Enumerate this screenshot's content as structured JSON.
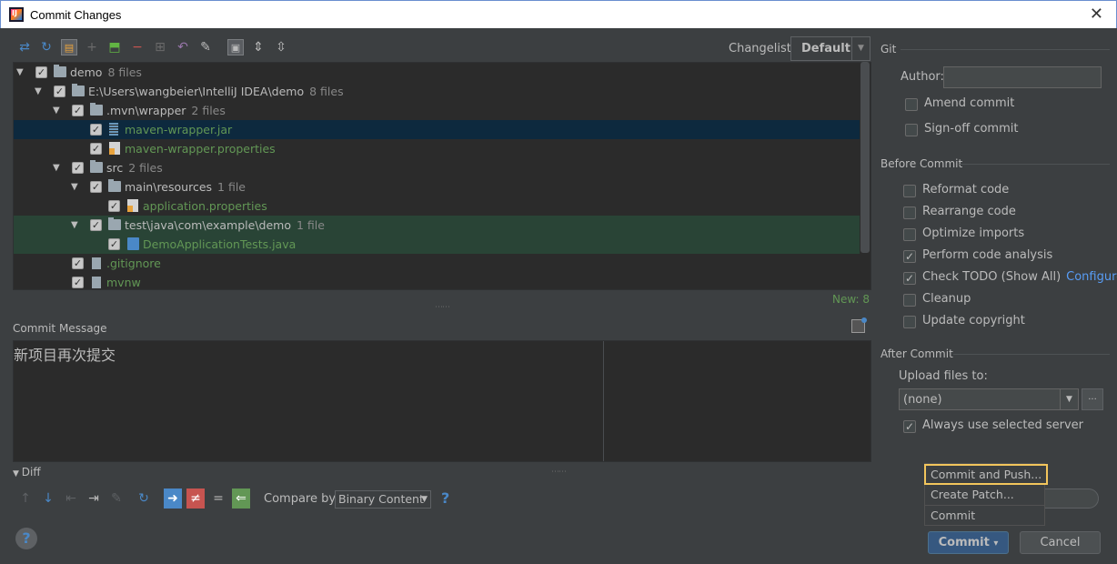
{
  "window": {
    "title": "Commit Changes",
    "close": "✕"
  },
  "toolbar": {
    "icons": [
      "show-diff-icon",
      "refresh-icon",
      "group-by-icon",
      "add-icon",
      "move-icon",
      "remove-icon",
      "compare-icon",
      "rollback-icon",
      "edit-icon",
      "toggle-icon",
      "expand-all-icon",
      "collapse-all-icon"
    ]
  },
  "changelist": {
    "label": "Changelist:",
    "value": "Default"
  },
  "tree": {
    "rows": [
      {
        "name": "demo",
        "count": "8 files"
      },
      {
        "name": "E:\\Users\\wangbeier\\IntelliJ IDEA\\demo",
        "count": "8 files"
      },
      {
        "name": ".mvn\\wrapper",
        "count": "2 files"
      },
      {
        "name": "maven-wrapper.jar",
        "count": ""
      },
      {
        "name": "maven-wrapper.properties",
        "count": ""
      },
      {
        "name": "src",
        "count": "2 files"
      },
      {
        "name": "main\\resources",
        "count": "1 file"
      },
      {
        "name": "application.properties",
        "count": ""
      },
      {
        "name": "test\\java\\com\\example\\demo",
        "count": "1 file"
      },
      {
        "name": "DemoApplicationTests.java",
        "count": ""
      },
      {
        "name": ".gitignore",
        "count": ""
      },
      {
        "name": "mvnw",
        "count": ""
      }
    ],
    "new_count": "New: 8"
  },
  "commit_message": {
    "label": "Commit Message",
    "text": "新项目再次提交"
  },
  "diff": {
    "label": "Diff",
    "compare_label": "Compare by:",
    "compare_value": "Binary Content",
    "help": "?"
  },
  "git": {
    "title": "Git",
    "author_label": "Author:",
    "author_value": "",
    "amend": {
      "label": "Amend commit",
      "checked": false
    },
    "signoff": {
      "label": "Sign-off commit",
      "checked": false
    }
  },
  "before_commit": {
    "title": "Before Commit",
    "options": [
      {
        "label": "Reformat code",
        "checked": false
      },
      {
        "label": "Rearrange code",
        "checked": false
      },
      {
        "label": "Optimize imports",
        "checked": false
      },
      {
        "label": "Perform code analysis",
        "checked": true
      },
      {
        "label": "Check TODO (Show All)",
        "checked": true
      },
      {
        "label": "Cleanup",
        "checked": false
      },
      {
        "label": "Update copyright",
        "checked": false
      }
    ],
    "configure_link": "Configure"
  },
  "after_commit": {
    "title": "After Commit",
    "upload_label": "Upload files to:",
    "upload_value": "(none)",
    "browse": "...",
    "always_use": {
      "label": "Always use selected server",
      "checked": true
    }
  },
  "commit_menu": {
    "items": [
      "Commit and Push...",
      "Create Patch...",
      "Commit"
    ]
  },
  "buttons": {
    "commit": "Commit",
    "commit_arrow": "▾",
    "cancel": "Cancel",
    "help": "?"
  }
}
